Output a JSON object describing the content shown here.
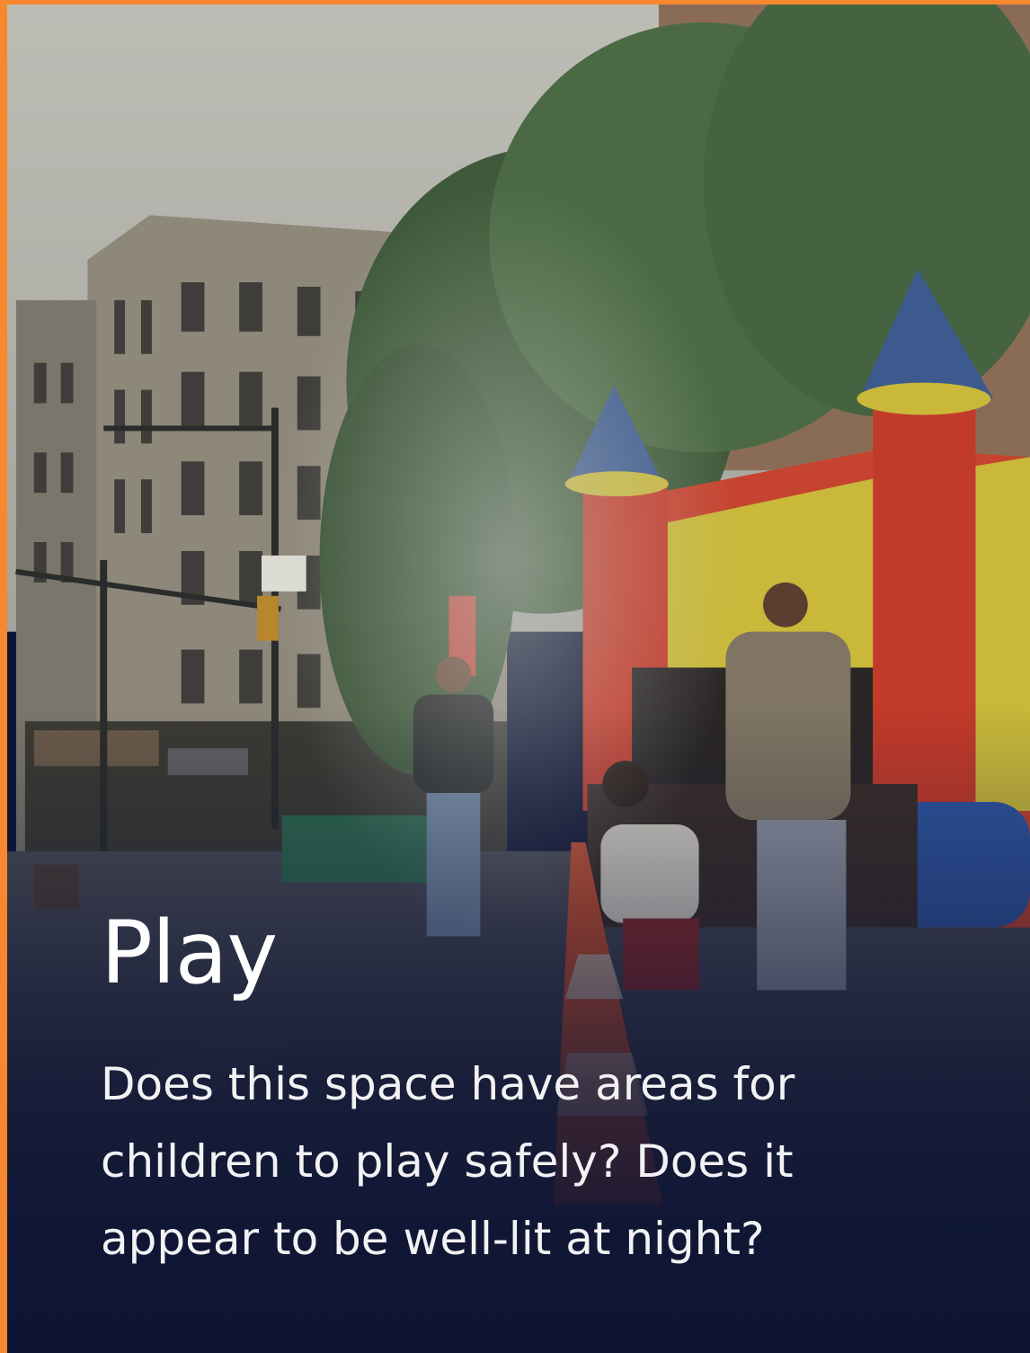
{
  "card": {
    "title": "Play",
    "description": "Does this space have areas for children to play safely? Does it appear to be well-lit at night?",
    "accent_color": "#f7882f"
  }
}
